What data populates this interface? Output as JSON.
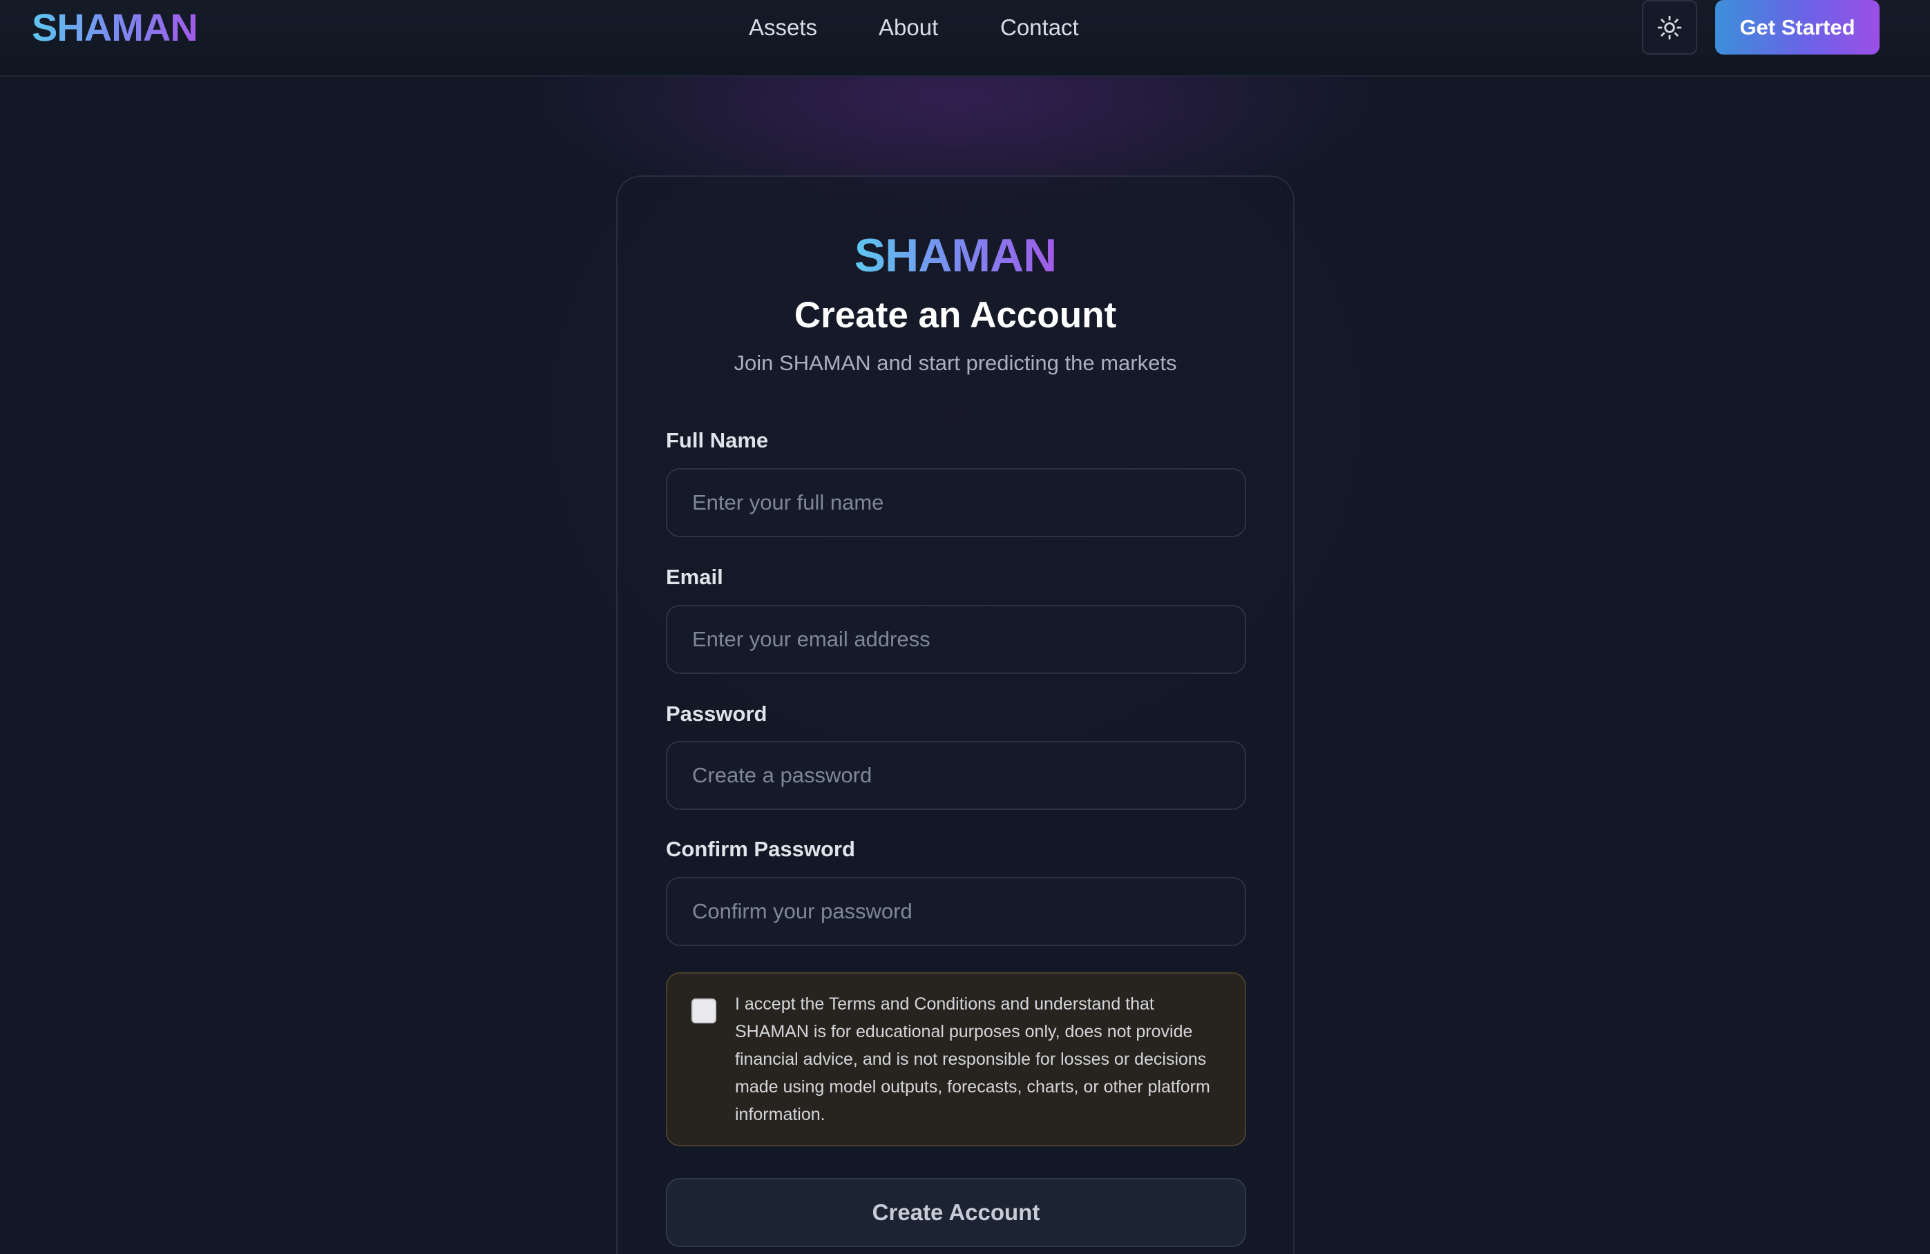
{
  "navbar": {
    "brand": "SHAMAN",
    "links": [
      {
        "label": "Assets"
      },
      {
        "label": "About"
      },
      {
        "label": "Contact"
      }
    ],
    "theme_toggle_icon": "sun-icon",
    "cta_label": "Get Started"
  },
  "form": {
    "logo": "SHAMAN",
    "title": "Create an Account",
    "subtitle": "Join SHAMAN and start predicting the markets",
    "fields": [
      {
        "label": "Full Name",
        "placeholder": "Enter your full name",
        "value": ""
      },
      {
        "label": "Email",
        "placeholder": "Enter your email address",
        "value": ""
      },
      {
        "label": "Password",
        "placeholder": "Create a password",
        "value": ""
      },
      {
        "label": "Confirm Password",
        "placeholder": "Confirm your password",
        "value": ""
      }
    ],
    "terms": {
      "checked": false,
      "text": "I accept the Terms and Conditions and understand that SHAMAN is for educational purposes only, does not provide financial advice, and is not responsible for losses or decisions made using model outputs, forecasts, charts, or other platform information."
    },
    "submit_label": "Create Account"
  },
  "colors": {
    "background": "#121826",
    "brand_gradient_start": "#5ec7ef",
    "brand_gradient_end": "#a25ae8",
    "terms_background": "#27241f"
  }
}
